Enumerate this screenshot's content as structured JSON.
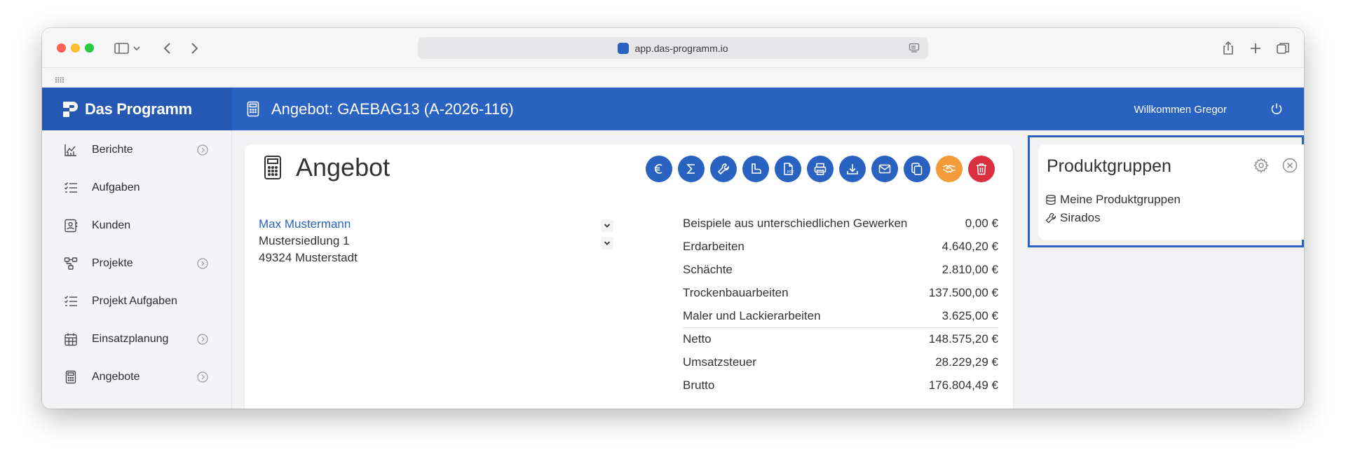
{
  "browser": {
    "url": "app.das-programm.io"
  },
  "app": {
    "brand": "Das Programm",
    "header_title": "Angebot: GAEBAG13 (A-2026-116)",
    "welcome": "Willkommen Gregor"
  },
  "sidebar": {
    "items": [
      {
        "label": "Berichte",
        "icon": "chart-line-icon",
        "has_chevron": true
      },
      {
        "label": "Aufgaben",
        "icon": "checklist-icon",
        "has_chevron": false
      },
      {
        "label": "Kunden",
        "icon": "contact-card-icon",
        "has_chevron": false
      },
      {
        "label": "Projekte",
        "icon": "hierarchy-icon",
        "has_chevron": true
      },
      {
        "label": "Projekt Aufgaben",
        "icon": "checklist-icon",
        "has_chevron": false
      },
      {
        "label": "Einsatzplanung",
        "icon": "calendar-icon",
        "has_chevron": true
      },
      {
        "label": "Angebote",
        "icon": "calculator-icon",
        "has_chevron": true
      }
    ]
  },
  "card": {
    "title": "Angebot",
    "actions": [
      "euro-icon",
      "sigma-icon",
      "wrench-icon",
      "boot-icon",
      "pdf-icon",
      "printer-icon",
      "download-icon",
      "mail-icon",
      "copy-icon",
      "handshake-icon",
      "trash-icon"
    ],
    "customer": {
      "name": "Max Mustermann",
      "street": "Mustersiedlung 1",
      "city": "49324 Musterstadt"
    },
    "summary": [
      {
        "label": "Beispiele aus unterschiedlichen Gewerken",
        "value": "0,00 €"
      },
      {
        "label": "Erdarbeiten",
        "value": "4.640,20 €"
      },
      {
        "label": "Schächte",
        "value": "2.810,00 €"
      },
      {
        "label": "Trockenbauarbeiten",
        "value": "137.500,00 €"
      },
      {
        "label": "Maler und Lackierarbeiten",
        "value": "3.625,00 €"
      }
    ],
    "totals": [
      {
        "label": "Netto",
        "value": "148.575,20 €"
      },
      {
        "label": "Umsatzsteuer",
        "value": "28.229,29 €"
      },
      {
        "label": "Brutto",
        "value": "176.804,49 €"
      }
    ]
  },
  "panel": {
    "title": "Produktgruppen",
    "items": [
      {
        "label": "Meine Produktgruppen",
        "icon": "database-icon"
      },
      {
        "label": "Sirados",
        "icon": "wrench-icon"
      }
    ]
  },
  "colors": {
    "primary": "#2a62c2",
    "orange": "#f29b38",
    "red": "#d92f3e"
  }
}
